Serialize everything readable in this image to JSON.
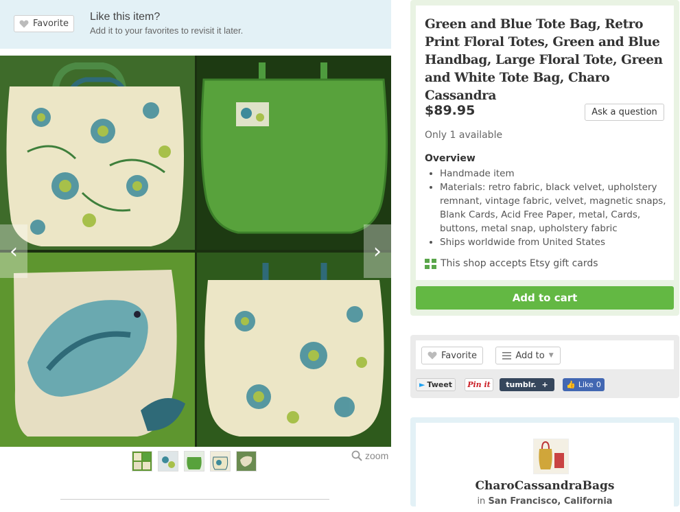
{
  "favorite_prompt": {
    "button_label": "Favorite",
    "title": "Like this item?",
    "subtitle": "Add it to your favorites to revisit it later."
  },
  "gallery": {
    "prev_icon": "chevron-left-icon",
    "next_icon": "chevron-right-icon",
    "thumbnail_count": 5,
    "zoom_label": "zoom"
  },
  "listing": {
    "title": "Green and Blue Tote Bag, Retro Print Floral Totes, Green and Blue Handbag, Large Floral Tote, Green and White Tote Bag, Charo Cassandra",
    "price": "$89.95",
    "ask_button": "Ask a question",
    "availability": "Only 1 available",
    "overview_heading": "Overview",
    "overview_items": [
      "Handmade item",
      "Materials: retro fabric, black velvet, upholstery remnant, vintage fabric, velvet, magnetic snaps, Blank Cards, Acid Free Paper, metal, Cards, buttons, metal snap, upholstery fabric",
      "Ships worldwide from United States"
    ],
    "gift_cards": "This shop accepts Etsy gift cards",
    "add_to_cart": "Add to cart"
  },
  "actions": {
    "favorite_label": "Favorite",
    "add_to_label": "Add to",
    "tweet": "Tweet",
    "pin": "Pin it",
    "tumblr": "tumblr.",
    "fb_like": "Like",
    "fb_count": "0"
  },
  "shop": {
    "name": "CharoCassandraBags",
    "location_prefix": "in",
    "location": "San Francisco, California"
  },
  "colors": {
    "accent_green": "#63b843",
    "prompt_blue": "#e3f1f6",
    "listing_bg": "#e9f3e3"
  }
}
